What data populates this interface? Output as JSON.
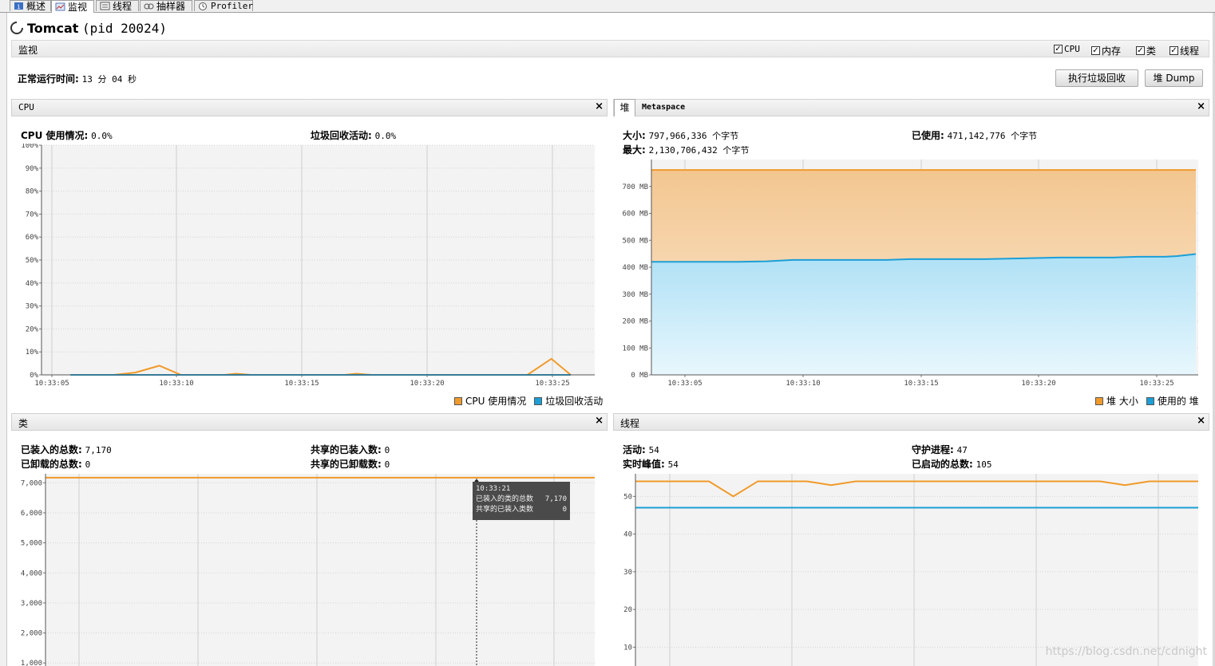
{
  "tabs": [
    {
      "label": "概述",
      "icon": "info-icon"
    },
    {
      "label": "监视",
      "icon": "monitor-icon",
      "active": true
    },
    {
      "label": "线程",
      "icon": "threads-icon"
    },
    {
      "label": "抽样器",
      "icon": "sampler-icon"
    },
    {
      "label": "Profiler",
      "icon": "profiler-icon"
    }
  ],
  "app": {
    "name": "Tomcat",
    "pid": "(pid 20024)"
  },
  "section": {
    "label": "监视",
    "checks": [
      {
        "label": "CPU",
        "checked": true
      },
      {
        "label": "内存",
        "checked": true
      },
      {
        "label": "类",
        "checked": true
      },
      {
        "label": "线程",
        "checked": true
      }
    ]
  },
  "uptime": {
    "label": "正常运行时间:",
    "value": "13 分 04 秒"
  },
  "buttons": {
    "gc": "执行垃圾回收",
    "dump": "堆 Dump"
  },
  "cpu_panel": {
    "title": "CPU",
    "stats": [
      {
        "label": "CPU 使用情况:",
        "value": "0.0%"
      },
      {
        "label": "垃圾回收活动:",
        "value": "0.0%"
      }
    ],
    "legend": [
      {
        "label": "CPU 使用情况",
        "color": "#f09a2a"
      },
      {
        "label": "垃圾回收活动",
        "color": "#1b9fd6"
      }
    ]
  },
  "heap_panel": {
    "tabs": [
      "堆",
      "Metaspace"
    ],
    "stats": [
      {
        "label": "大小:",
        "value": "797,966,336 个字节"
      },
      {
        "label": "已使用:",
        "value": "471,142,776 个字节"
      },
      {
        "label": "最大:",
        "value": "2,130,706,432 个字节"
      }
    ],
    "legend": [
      {
        "label": "堆 大小",
        "color": "#f09a2a"
      },
      {
        "label": "使用的 堆",
        "color": "#1b9fd6"
      }
    ]
  },
  "classes_panel": {
    "title": "类",
    "stats": [
      {
        "label": "已装入的总数:",
        "value": "7,170"
      },
      {
        "label": "共享的已装入数:",
        "value": "0"
      },
      {
        "label": "已卸载的总数:",
        "value": "0"
      },
      {
        "label": "共享的已卸载数:",
        "value": "0"
      }
    ],
    "tooltip": {
      "time": "10:33:21",
      "rows": [
        {
          "label": "已装入的类的总数",
          "value": "7,170"
        },
        {
          "label": "共享的已装入类数",
          "value": "0"
        }
      ]
    }
  },
  "threads_panel": {
    "title": "线程",
    "stats": [
      {
        "label": "活动:",
        "value": "54"
      },
      {
        "label": "守护进程:",
        "value": "47"
      },
      {
        "label": "实时峰值:",
        "value": "54"
      },
      {
        "label": "已启动的总数:",
        "value": "105"
      }
    ]
  },
  "watermark": "https://blog.csdn.net/cdnight",
  "chart_data": [
    {
      "type": "line",
      "id": "cpu",
      "xticks": [
        "10:33:05",
        "10:33:10",
        "10:33:15",
        "10:33:20",
        "10:33:25"
      ],
      "yticks": [
        "0%",
        "10%",
        "20%",
        "30%",
        "40%",
        "50%",
        "60%",
        "70%",
        "80%",
        "90%",
        "100%"
      ],
      "ylim": [
        0,
        100
      ],
      "series": [
        {
          "name": "CPU 使用情况",
          "color": "#f09a2a",
          "points": [
            [
              0,
              0
            ],
            [
              1.8,
              0
            ],
            [
              2.7,
              1
            ],
            [
              3.7,
              4
            ],
            [
              4.6,
              0
            ],
            [
              6.4,
              0
            ],
            [
              6.9,
              0.5
            ],
            [
              7.5,
              0
            ],
            [
              11.4,
              0
            ],
            [
              11.9,
              0.5
            ],
            [
              12.5,
              0
            ],
            [
              19,
              0
            ],
            [
              20.0,
              7
            ],
            [
              20.8,
              0
            ]
          ]
        },
        {
          "name": "垃圾回收活动",
          "color": "#1b9fd6",
          "points": [
            [
              0,
              0
            ],
            [
              20.8,
              0
            ]
          ]
        }
      ],
      "xrange": [
        -1.2,
        21.8
      ]
    },
    {
      "type": "area",
      "id": "heap",
      "xticks": [
        "10:33:05",
        "10:33:10",
        "10:33:15",
        "10:33:20",
        "10:33:25"
      ],
      "yticks": [
        "0 MB",
        "100 MB",
        "200 MB",
        "300 MB",
        "400 MB",
        "500 MB",
        "600 MB",
        "700 MB"
      ],
      "ylim": [
        0,
        800
      ],
      "series": [
        {
          "name": "堆 大小",
          "color": "#f09a2a",
          "points": [
            [
              -0.7,
              761
            ],
            [
              22,
              761
            ]
          ]
        },
        {
          "name": "使用的 堆",
          "color": "#1b9fd6",
          "points": [
            [
              -0.7,
              420
            ],
            [
              2.9,
              420
            ],
            [
              4.1,
              422
            ],
            [
              5.2,
              427
            ],
            [
              7.9,
              427
            ],
            [
              9.1,
              427
            ],
            [
              10.1,
              430
            ],
            [
              13.2,
              430
            ],
            [
              14.2,
              432
            ],
            [
              16.3,
              436
            ],
            [
              17.6,
              436
            ],
            [
              18.6,
              436
            ],
            [
              19.6,
              439
            ],
            [
              20.7,
              439
            ],
            [
              21.2,
              441
            ],
            [
              22,
              449
            ]
          ]
        }
      ],
      "xrange": [
        -0.7,
        22.1
      ]
    },
    {
      "type": "line",
      "id": "classes",
      "yticks": [
        "1,000",
        "2,000",
        "3,000",
        "4,000",
        "5,000",
        "6,000",
        "7,000"
      ],
      "ylim": [
        900,
        7300
      ],
      "series": [
        {
          "name": "已装入的类的总数",
          "color": "#f09a2a",
          "points": [
            [
              0,
              7170
            ],
            [
              1,
              7170
            ]
          ]
        },
        {
          "name": "共享的已装入类数",
          "color": "#1b9fd6",
          "points": [
            [
              0,
              0
            ],
            [
              1,
              0
            ]
          ]
        }
      ]
    },
    {
      "type": "line",
      "id": "threads",
      "yticks": [
        "10",
        "20",
        "30",
        "40",
        "50"
      ],
      "ylim": [
        5,
        56
      ],
      "series": [
        {
          "name": "活动",
          "color": "#f09a2a",
          "points": [
            [
              0,
              54
            ],
            [
              3,
              54
            ],
            [
              4,
              50
            ],
            [
              5,
              54
            ],
            [
              7,
              54
            ],
            [
              8,
              53
            ],
            [
              9,
              54
            ],
            [
              19,
              54
            ],
            [
              20,
              53
            ],
            [
              21,
              54
            ],
            [
              23,
              54
            ]
          ]
        },
        {
          "name": "守护进程",
          "color": "#1b9fd6",
          "points": [
            [
              0,
              47
            ],
            [
              23,
              47
            ]
          ]
        }
      ]
    }
  ]
}
